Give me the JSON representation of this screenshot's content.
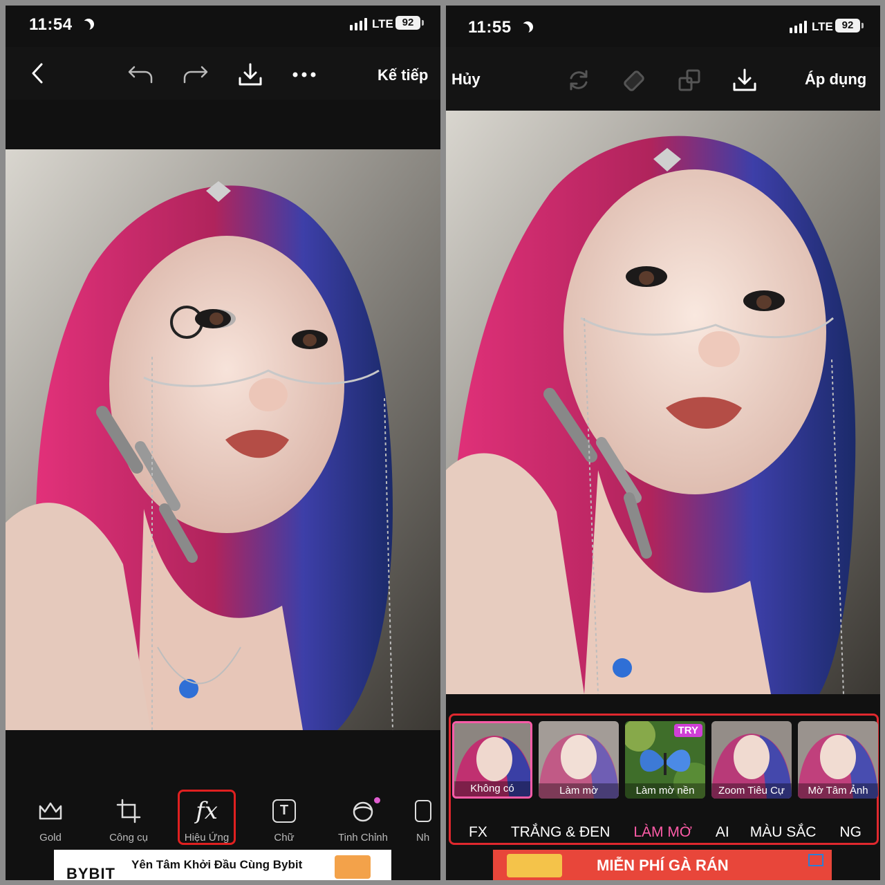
{
  "left": {
    "status": {
      "time": "11:54",
      "network": "LTE",
      "battery": "92"
    },
    "topbar": {
      "back_icon": "chevron-left-icon",
      "undo_icon": "undo-icon",
      "redo_icon": "redo-icon",
      "download_icon": "download-icon",
      "more_icon": "more-dots-icon",
      "next_label": "Kế tiếp"
    },
    "tools": [
      {
        "label": "Gold",
        "icon": "crown-icon"
      },
      {
        "label": "Công cụ",
        "icon": "crop-icon"
      },
      {
        "label": "Hiệu Ứng",
        "icon": "fx-icon",
        "glyph": "fx"
      },
      {
        "label": "Chữ",
        "icon": "text-icon",
        "glyph": "T"
      },
      {
        "label": "Tinh Chỉnh",
        "icon": "retouch-icon"
      },
      {
        "label": "Nh",
        "icon": "more-tool-icon"
      }
    ],
    "ad": {
      "brand": "BYBIT",
      "text": "Yên Tâm Khởi Đầu Cùng Bybit"
    }
  },
  "right": {
    "status": {
      "time": "11:55",
      "network": "LTE",
      "battery": "92"
    },
    "topbar": {
      "cancel_label": "Hủy",
      "apply_label": "Áp dụng"
    },
    "effects": [
      {
        "label": "Không có",
        "selected": true
      },
      {
        "label": "Làm mờ"
      },
      {
        "label": "Làm mờ nền",
        "badge": "TRY"
      },
      {
        "label": "Zoom Tiêu Cự"
      },
      {
        "label": "Mờ Tâm Ảnh"
      }
    ],
    "categories": [
      "FX",
      "TRẮNG & ĐEN",
      "LÀM MỜ",
      "AI",
      "MÀU SẮC",
      "NG"
    ],
    "active_category": "LÀM MỜ",
    "ad": {
      "text": "MIỄN PHÍ GÀ RÁN"
    }
  },
  "colors": {
    "accent_pink": "#ff5ca8",
    "highlight_red": "#e02020"
  }
}
